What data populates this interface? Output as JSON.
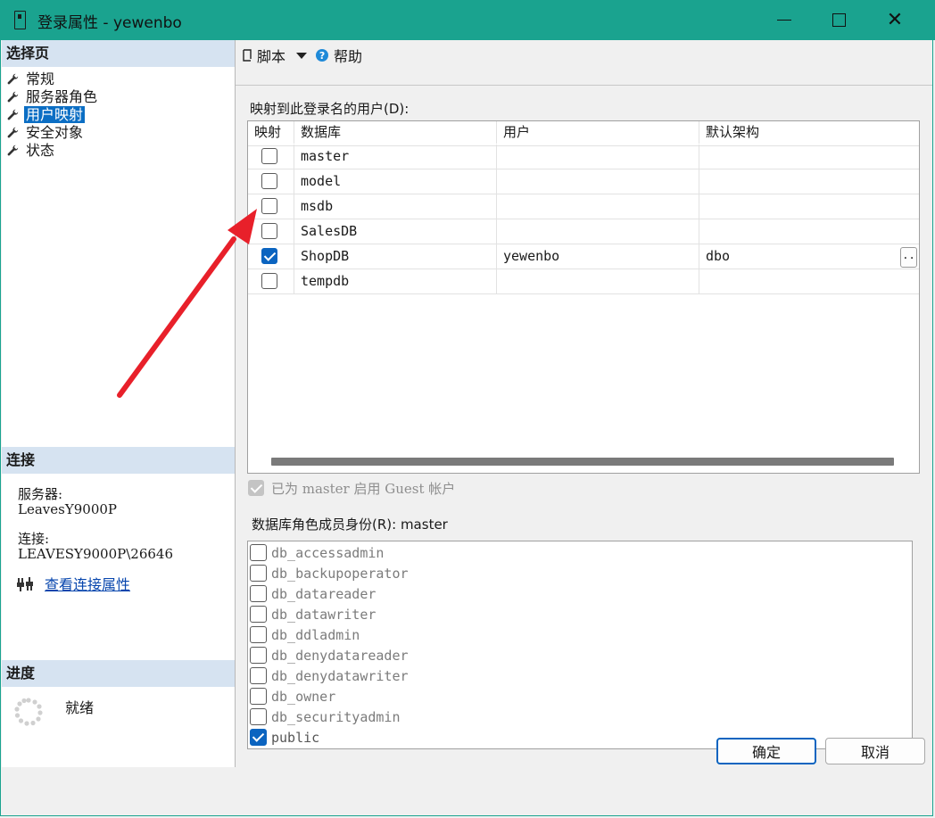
{
  "window": {
    "title": "登录属性 - yewenbo"
  },
  "left": {
    "select_page_header": "选择页",
    "nav": [
      {
        "label": "常规",
        "selected": false
      },
      {
        "label": "服务器角色",
        "selected": false
      },
      {
        "label": "用户映射",
        "selected": true
      },
      {
        "label": "安全对象",
        "selected": false
      },
      {
        "label": "状态",
        "selected": false
      }
    ],
    "connection_header": "连接",
    "server_label": "服务器:",
    "server_value": "LeavesY9000P",
    "connection_label": "连接:",
    "connection_value": "LEAVESY9000P\\26646",
    "view_connection_link": "查看连接属性",
    "progress_header": "进度",
    "progress_status": "就绪"
  },
  "toolbar": {
    "script_label": "脚本",
    "help_label": "帮助"
  },
  "mapping": {
    "label": "映射到此登录名的用户(D):",
    "columns": [
      "映射",
      "数据库",
      "用户",
      "默认架构"
    ],
    "rows": [
      {
        "checked": false,
        "database": "master",
        "user": "",
        "schema": ""
      },
      {
        "checked": false,
        "database": "model",
        "user": "",
        "schema": ""
      },
      {
        "checked": false,
        "database": "msdb",
        "user": "",
        "schema": ""
      },
      {
        "checked": false,
        "database": "SalesDB",
        "user": "",
        "schema": ""
      },
      {
        "checked": true,
        "database": "ShopDB",
        "user": "yewenbo",
        "schema": "dbo"
      },
      {
        "checked": false,
        "database": "tempdb",
        "user": "",
        "schema": ""
      }
    ],
    "ellipsis": ".."
  },
  "guest": {
    "label": "已为 master 启用 Guest 帐户",
    "checked": true,
    "disabled": true
  },
  "roles": {
    "label": "数据库角色成员身份(R): master",
    "items": [
      {
        "name": "db_accessadmin",
        "checked": false
      },
      {
        "name": "db_backupoperator",
        "checked": false
      },
      {
        "name": "db_datareader",
        "checked": false
      },
      {
        "name": "db_datawriter",
        "checked": false
      },
      {
        "name": "db_ddladmin",
        "checked": false
      },
      {
        "name": "db_denydatareader",
        "checked": false
      },
      {
        "name": "db_denydatawriter",
        "checked": false
      },
      {
        "name": "db_owner",
        "checked": false
      },
      {
        "name": "db_securityadmin",
        "checked": false
      },
      {
        "name": "public",
        "checked": true
      }
    ]
  },
  "buttons": {
    "ok": "确定",
    "cancel": "取消"
  },
  "colors": {
    "titlebar": "#1aa38f",
    "selection": "#0b6ec4",
    "annotation_arrow": "#e8202a"
  }
}
